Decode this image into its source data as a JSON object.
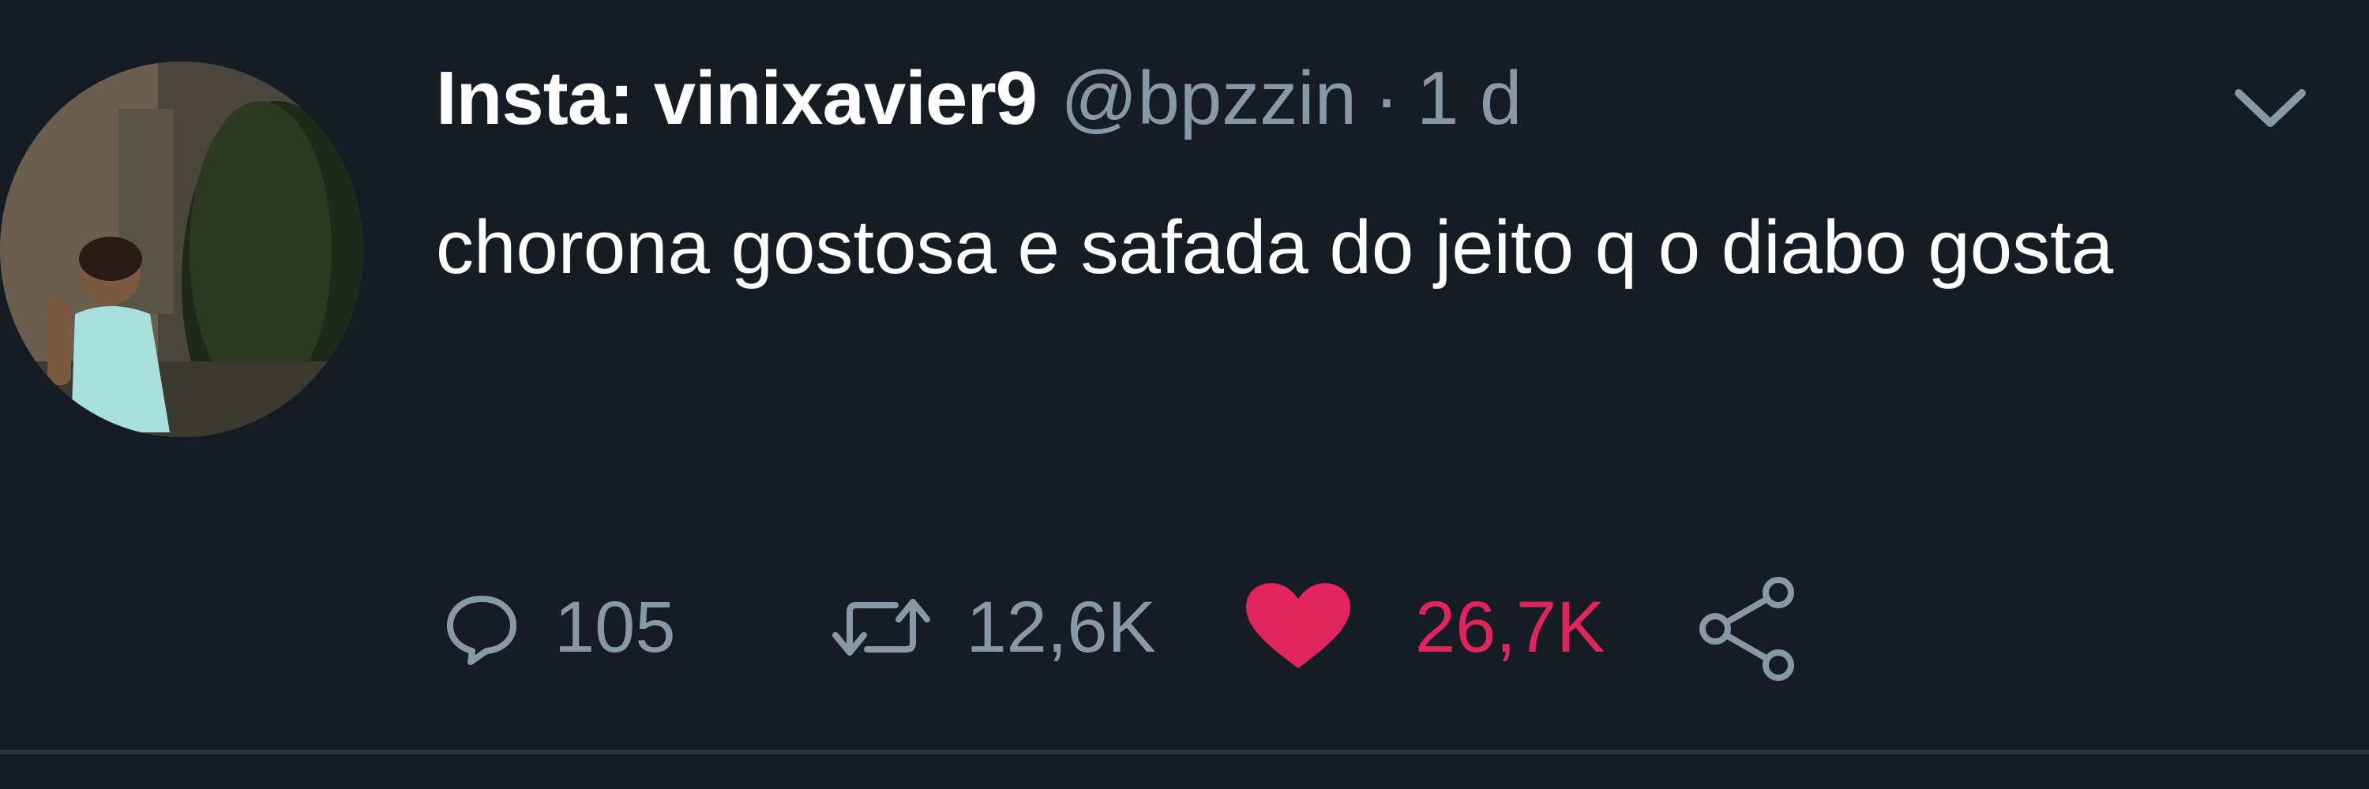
{
  "tweet": {
    "display_name": "Insta: vinixavier9",
    "handle": "@bpzzin",
    "separator": "·",
    "timestamp": "1 d",
    "text": "chorona gostosa e safada do jeito q o diabo gosta",
    "actions": {
      "reply_count": "105",
      "retweet_count": "12,6K",
      "like_count": "26,7K"
    },
    "icons": {
      "avatar": "user-avatar",
      "menu": "chevron-down-icon",
      "reply": "reply-icon",
      "retweet": "retweet-icon",
      "like": "heart-icon",
      "share": "share-icon"
    },
    "colors": {
      "background": "#151c24",
      "text": "#ffffff",
      "muted": "#8899a6",
      "like": "#e0245e"
    }
  }
}
